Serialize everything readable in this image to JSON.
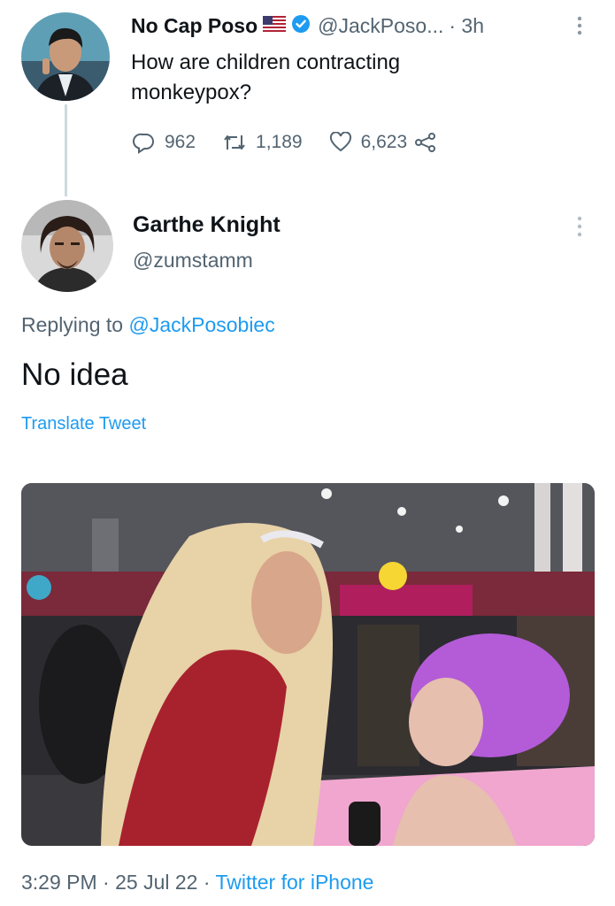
{
  "parent_tweet": {
    "display_name": "No Cap Poso",
    "flag": "us-flag-icon",
    "handle": "@JackPoso...",
    "time": "· 3h",
    "text_line1": "How are children contracting",
    "text_line2": "monkeypox?",
    "replies": "962",
    "retweets": "1,189",
    "likes": "6,623"
  },
  "reply_tweet": {
    "display_name": "Garthe Knight",
    "handle": "@zumstamm",
    "replying_prefix": "Replying to",
    "replying_handle": "@JackPosobiec",
    "text": "No idea",
    "translate_label": "Translate Tweet",
    "timestamp": "3:29 PM · 25 Jul 22 ·",
    "source": "Twitter for iPhone"
  },
  "colors": {
    "link": "#1d9bf0",
    "secondary_text": "#536471",
    "verified": "#1d9bf0"
  }
}
